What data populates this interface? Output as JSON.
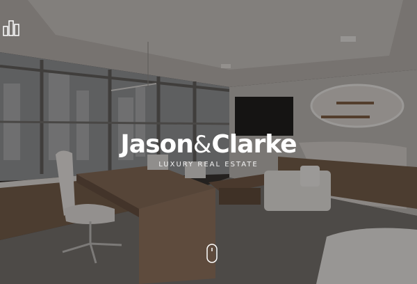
{
  "brand": {
    "name_first": "Jason",
    "ampersand": "&",
    "name_second": "Clarke",
    "tagline": "LUXURY REAL ESTATE"
  },
  "header": {
    "logo_icon": "building-bars-icon"
  },
  "hero": {
    "background": "office-interior-photo",
    "scroll_icon": "mouse-scroll-icon"
  },
  "colors": {
    "text": "#ffffff",
    "overlay": "#141211"
  }
}
